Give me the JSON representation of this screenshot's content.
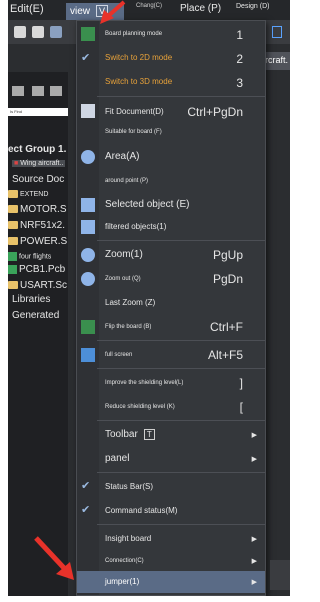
{
  "menubar": {
    "edit": "Edit(E)",
    "view": "view",
    "view_accel": "V",
    "change": "Chang(C)",
    "place": "Place (P)",
    "design": "Design (D)"
  },
  "tabs": {
    "right_tab": "aircraft."
  },
  "left_panel": {
    "search_text": "Is Find",
    "items": [
      {
        "label": "ect Group 1."
      },
      {
        "label": "Wing aircraft.."
      },
      {
        "label": "Source Doc"
      },
      {
        "label": "EXTEND"
      },
      {
        "label": "MOTOR.S"
      },
      {
        "label": "NRF51x2."
      },
      {
        "label": "POWER.S"
      },
      {
        "label": "four flights"
      },
      {
        "label": "PCB1.Pcb"
      },
      {
        "label": "USART.Sc"
      },
      {
        "label": "Libraries"
      },
      {
        "label": "Generated"
      }
    ]
  },
  "view_menu": {
    "items": [
      {
        "label": "Board planning mode",
        "shortcut": "1"
      },
      {
        "label": "Switch to 2D mode",
        "shortcut": "2"
      },
      {
        "label": "Switch to 3D mode",
        "shortcut": "3"
      },
      {
        "label": "Fit Document(D)",
        "shortcut": "Ctrl+PgDn"
      },
      {
        "label": "Suitable for board (F)"
      },
      {
        "label": "Area(A)"
      },
      {
        "label": "around point (P)"
      },
      {
        "label": "Selected object (E)"
      },
      {
        "label": "filtered objects(1)"
      },
      {
        "label": "Zoom(1)",
        "shortcut": "PgUp"
      },
      {
        "label": "Zoom out (Q)",
        "shortcut": "PgDn"
      },
      {
        "label": "Last Zoom (Z)"
      },
      {
        "label": "Flip the board (B)",
        "shortcut": "Ctrl+F"
      },
      {
        "label": "full screen",
        "shortcut": "Alt+F5"
      },
      {
        "label": "Improve the shielding level(L)",
        "shortcut": "]"
      },
      {
        "label": "Reduce shielding level (K)",
        "shortcut": "["
      },
      {
        "label": "Toolbar",
        "accel": "T"
      },
      {
        "label": "panel"
      },
      {
        "label": "Status Bar(S)"
      },
      {
        "label": "Command status(M)"
      },
      {
        "label": "Insight board"
      },
      {
        "label": "Connection(C)"
      },
      {
        "label": "jumper(1)"
      }
    ]
  },
  "colors": {
    "highlight": "#5a6b86",
    "menu_bg": "#34373b",
    "orange_text": "#e8a23a",
    "arrow": "#e8322a"
  }
}
